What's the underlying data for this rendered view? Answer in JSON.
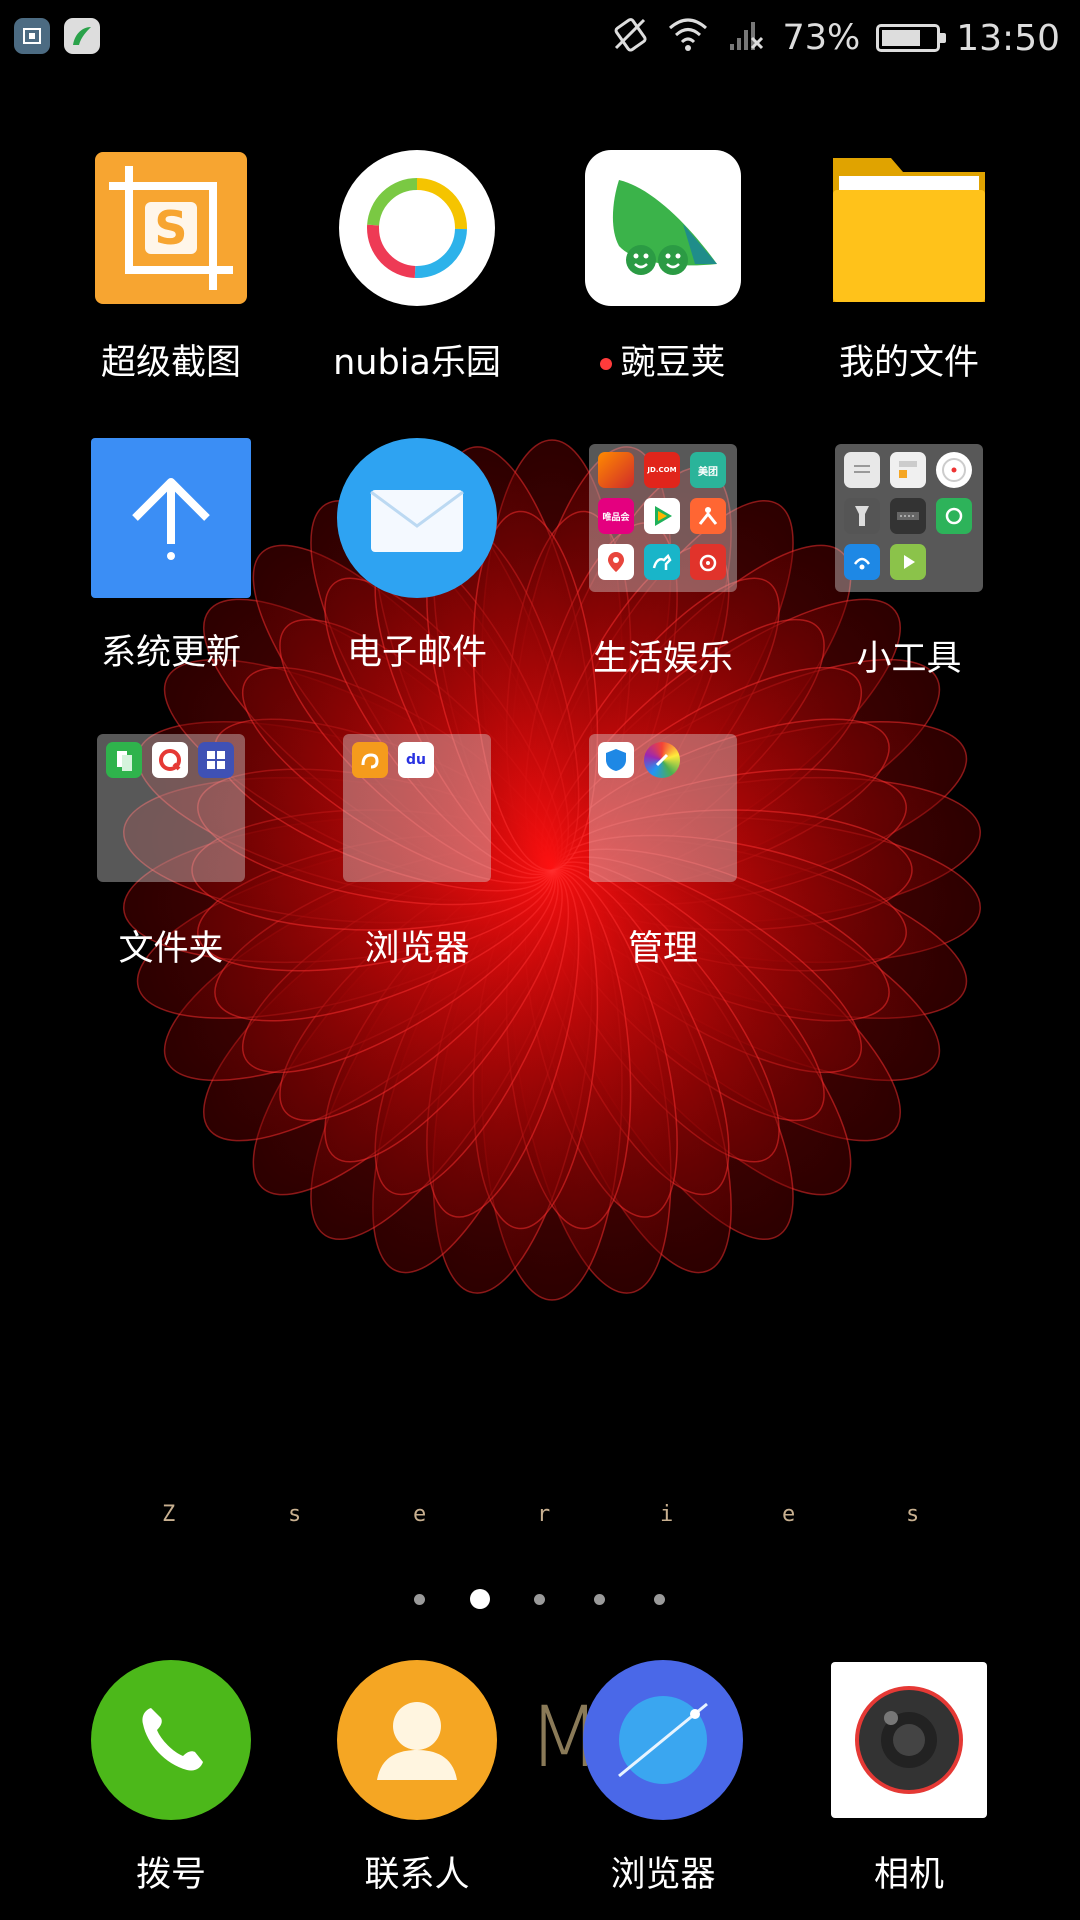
{
  "status_bar": {
    "left_icons": [
      "screenshot-notification-icon",
      "wandoujia-notification-icon"
    ],
    "right_icons": [
      "auto-rotate-off-icon",
      "wifi-icon",
      "cellular-no-signal-icon"
    ],
    "battery_percent": "73%",
    "battery_level": 0.73,
    "time": "13:50"
  },
  "apps": [
    {
      "label": "超级截图",
      "icon": "super-screenshot-icon",
      "color": "#f7a531"
    },
    {
      "label": "nubia乐园",
      "icon": "nubia-park-icon",
      "color": "#ffffff"
    },
    {
      "label": "豌豆荚",
      "icon": "wandoujia-icon",
      "color": "#3bb34a",
      "has_new_badge": true
    },
    {
      "label": "我的文件",
      "icon": "my-files-folder-icon",
      "color": "#ffc21a"
    },
    {
      "label": "系统更新",
      "icon": "system-update-icon",
      "color": "#3b8ef5"
    },
    {
      "label": "电子邮件",
      "icon": "email-icon",
      "color": "#2ea3f2"
    },
    {
      "label": "生活娱乐",
      "icon": "folder-icon",
      "folder": true
    },
    {
      "label": "小工具",
      "icon": "folder-icon",
      "folder": true
    },
    {
      "label": "文件夹",
      "icon": "folder-icon",
      "folder": true
    },
    {
      "label": "浏览器",
      "icon": "folder-icon",
      "folder": true
    },
    {
      "label": "管理",
      "icon": "folder-icon",
      "folder": true
    }
  ],
  "folder_contents": {
    "life_entertainment": {
      "apps": [
        "game-icon",
        "jd-icon",
        "meituan-icon",
        "vipshop-icon",
        "tencent-video-icon",
        "dianping-icon",
        "baidu-maps-icon",
        "qunar-icon",
        "netease-music-icon"
      ],
      "texts": [
        "JD.COM",
        "美团",
        "唯品会"
      ]
    },
    "tools": {
      "apps": [
        "notes-icon",
        "calculator-icon",
        "clock-icon",
        "flashlight-icon",
        "recorder-icon",
        "sync-icon",
        "remote-icon",
        "video-player-icon"
      ]
    },
    "folder": {
      "apps": [
        "green-files-icon",
        "red-q-icon",
        "windows-icon"
      ]
    },
    "browser": {
      "apps": [
        "uc-browser-icon",
        "baidu-icon"
      ],
      "texts": [
        "du"
      ]
    },
    "manage": {
      "apps": [
        "security-shield-icon",
        "cleaner-icon"
      ]
    }
  },
  "wallpaper_text": {
    "letters": [
      "Z",
      "s",
      "e",
      "r",
      "i",
      "e",
      "s"
    ],
    "dock_letter": "M"
  },
  "page_indicator": {
    "count": 5,
    "active_index": 1
  },
  "dock": [
    {
      "label": "拨号",
      "icon": "phone-icon",
      "color": "#4cb81a"
    },
    {
      "label": "联系人",
      "icon": "contacts-icon",
      "color": "#f5a623"
    },
    {
      "label": "浏览器",
      "icon": "browser-icon",
      "color": "#4a68e8"
    },
    {
      "label": "相机",
      "icon": "camera-icon",
      "color": "#ffffff"
    }
  ]
}
